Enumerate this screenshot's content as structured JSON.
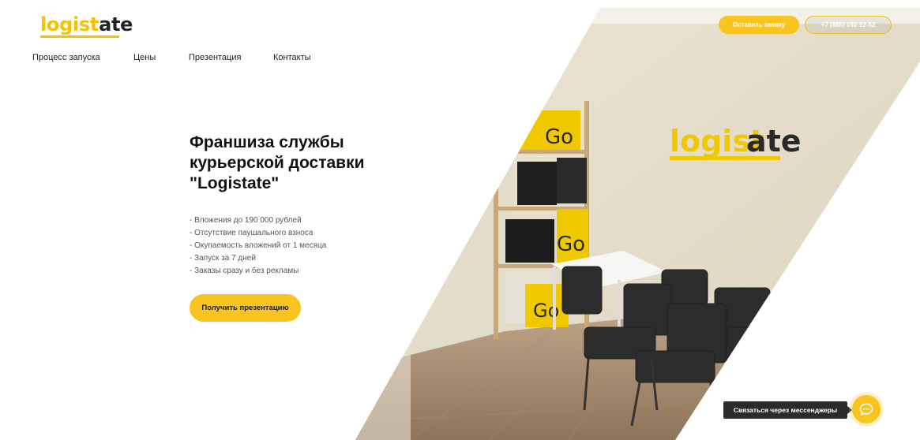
{
  "header": {
    "logo_part1": "logist",
    "logo_part2": "ate",
    "request_button": "Оставить заявку",
    "phone": "+7 (985) 092-92-52"
  },
  "nav": {
    "items": [
      "Процесс запуска",
      "Цены",
      "Презентация",
      "Контакты"
    ]
  },
  "hero": {
    "title_line1": "Франшиза службы",
    "title_line2": "курьерской доставки",
    "title_line3": "\"Logistate\"",
    "bullets": [
      "- Вложения до 190 000 рублей",
      "- Отсутствие паушального взноса",
      "- Окупаемость вложений от 1 месяца",
      "- Запуск за 7 дней",
      "- Заказы сразу и без рекламы"
    ],
    "cta": "Получить презентацию"
  },
  "photo": {
    "wall_logo_part1": "logist",
    "wall_logo_part2": "ate",
    "box_label": "Go"
  },
  "messenger": {
    "label": "Связаться через мессенджеры",
    "icon": "chat-bubble-icon"
  },
  "colors": {
    "accent": "#f9c320",
    "dark": "#2b2b2b"
  }
}
